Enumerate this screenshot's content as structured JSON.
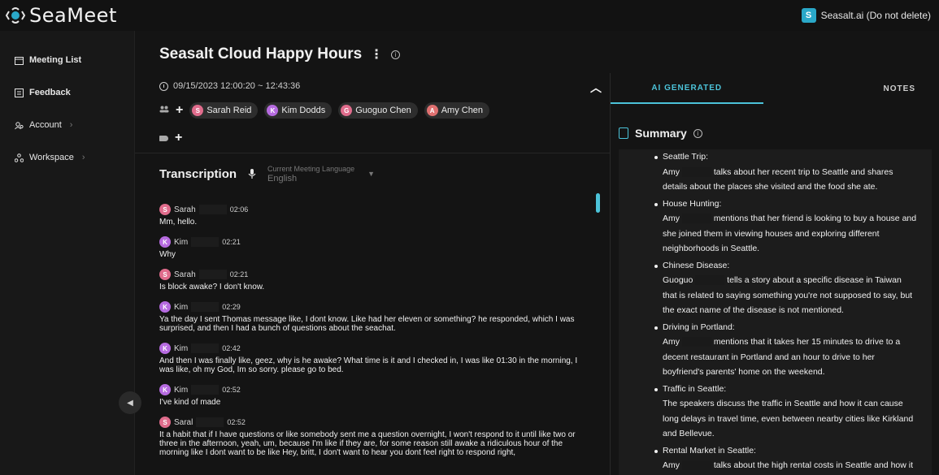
{
  "app": {
    "logo_text": "SeaMeet"
  },
  "workspace": {
    "badge": "S",
    "name": "Seasalt.ai (Do not delete)"
  },
  "sidebar": {
    "items": [
      {
        "label": "Meeting List",
        "icon": "calendar-icon"
      },
      {
        "label": "Feedback",
        "icon": "feedback-icon"
      },
      {
        "label": "Account",
        "icon": "account-icon"
      },
      {
        "label": "Workspace",
        "icon": "workspace-icon"
      }
    ]
  },
  "meeting": {
    "title": "Seasalt Cloud Happy Hours",
    "datetime": "09/15/2023 12:00:20 ~ 12:43:36",
    "participants": [
      {
        "initial": "S",
        "name": "Sarah Reid",
        "color": "#e06c8c"
      },
      {
        "initial": "K",
        "name": "Kim Dodds",
        "color": "#b66be0"
      },
      {
        "initial": "G",
        "name": "Guoguo Chen",
        "color": "#e06c8c"
      },
      {
        "initial": "A",
        "name": "Amy Chen",
        "color": "#e07070"
      }
    ]
  },
  "transcription": {
    "title": "Transcription",
    "language_label": "Current Meeting Language",
    "language_value": "English",
    "entries": [
      {
        "initial": "S",
        "color": "#e06c8c",
        "speaker": "Sarah",
        "time": "02:06",
        "text": "Mm, hello."
      },
      {
        "initial": "K",
        "color": "#b66be0",
        "speaker": "Kim",
        "time": "02:21",
        "text": "Why"
      },
      {
        "initial": "S",
        "color": "#e06c8c",
        "speaker": "Sarah",
        "time": "02:21",
        "text": "Is block awake? I don't know."
      },
      {
        "initial": "K",
        "color": "#b66be0",
        "speaker": "Kim",
        "time": "02:29",
        "text": "Ya the day I sent Thomas message like, I dont know. Like had her eleven or something? he responded, which I was surprised, and then I had a bunch of questions about the seachat."
      },
      {
        "initial": "K",
        "color": "#b66be0",
        "speaker": "Kim",
        "time": "02:42",
        "text": "And then I was finally like, geez, why is he awake? What time is it and I checked in, I was like 01:30 in the morning, I was like, oh my God, Im so sorry. please go to bed."
      },
      {
        "initial": "K",
        "color": "#b66be0",
        "speaker": "Kim",
        "time": "02:52",
        "text": "I've kind of made"
      },
      {
        "initial": "S",
        "color": "#e06c8c",
        "speaker": "Saral",
        "time": "02:52",
        "text": "It a habit that if I have questions or like somebody sent me a question overnight, I won't respond to it until like two or three in the afternoon, yeah, um, because I'm like if they are, for some reason still awake a ridiculous hour of the morning like I dont want to be like Hey, britt, I don't want to hear you dont feel right to respond right,"
      }
    ]
  },
  "tabs": {
    "ai": "AI GENERATED",
    "notes": "NOTES"
  },
  "summary": {
    "title": "Summary",
    "items": [
      {
        "title": "Seattle Trip:",
        "lead": "Amy",
        "body": "talks about her recent trip to Seattle and shares details about the places she visited and the food she ate."
      },
      {
        "title": "House Hunting:",
        "lead": "Amy",
        "body": "mentions that her friend is looking to buy a house and she joined them in viewing houses and exploring different neighborhoods in Seattle."
      },
      {
        "title": "Chinese Disease:",
        "lead": "Guoguo",
        "body": "tells a story about a specific disease in Taiwan that is related to saying something you're not supposed to say, but the exact name of the disease is not mentioned."
      },
      {
        "title": "Driving in Portland:",
        "lead": "Amy",
        "body": "mentions that it takes her 15 minutes to drive to a decent restaurant in Portland and an hour to drive to her boyfriend's parents' home on the weekend."
      },
      {
        "title": "Traffic in Seattle:",
        "lead": "",
        "body": "The speakers discuss the traffic in Seattle and how it can cause long delays in travel time, even between nearby cities like Kirkland and Bellevue."
      },
      {
        "title": "Rental Market in Seattle:",
        "lead": "Amy",
        "body": "talks about the high rental costs in Seattle and how it may not make financial sense to rent out a property due to"
      }
    ]
  }
}
